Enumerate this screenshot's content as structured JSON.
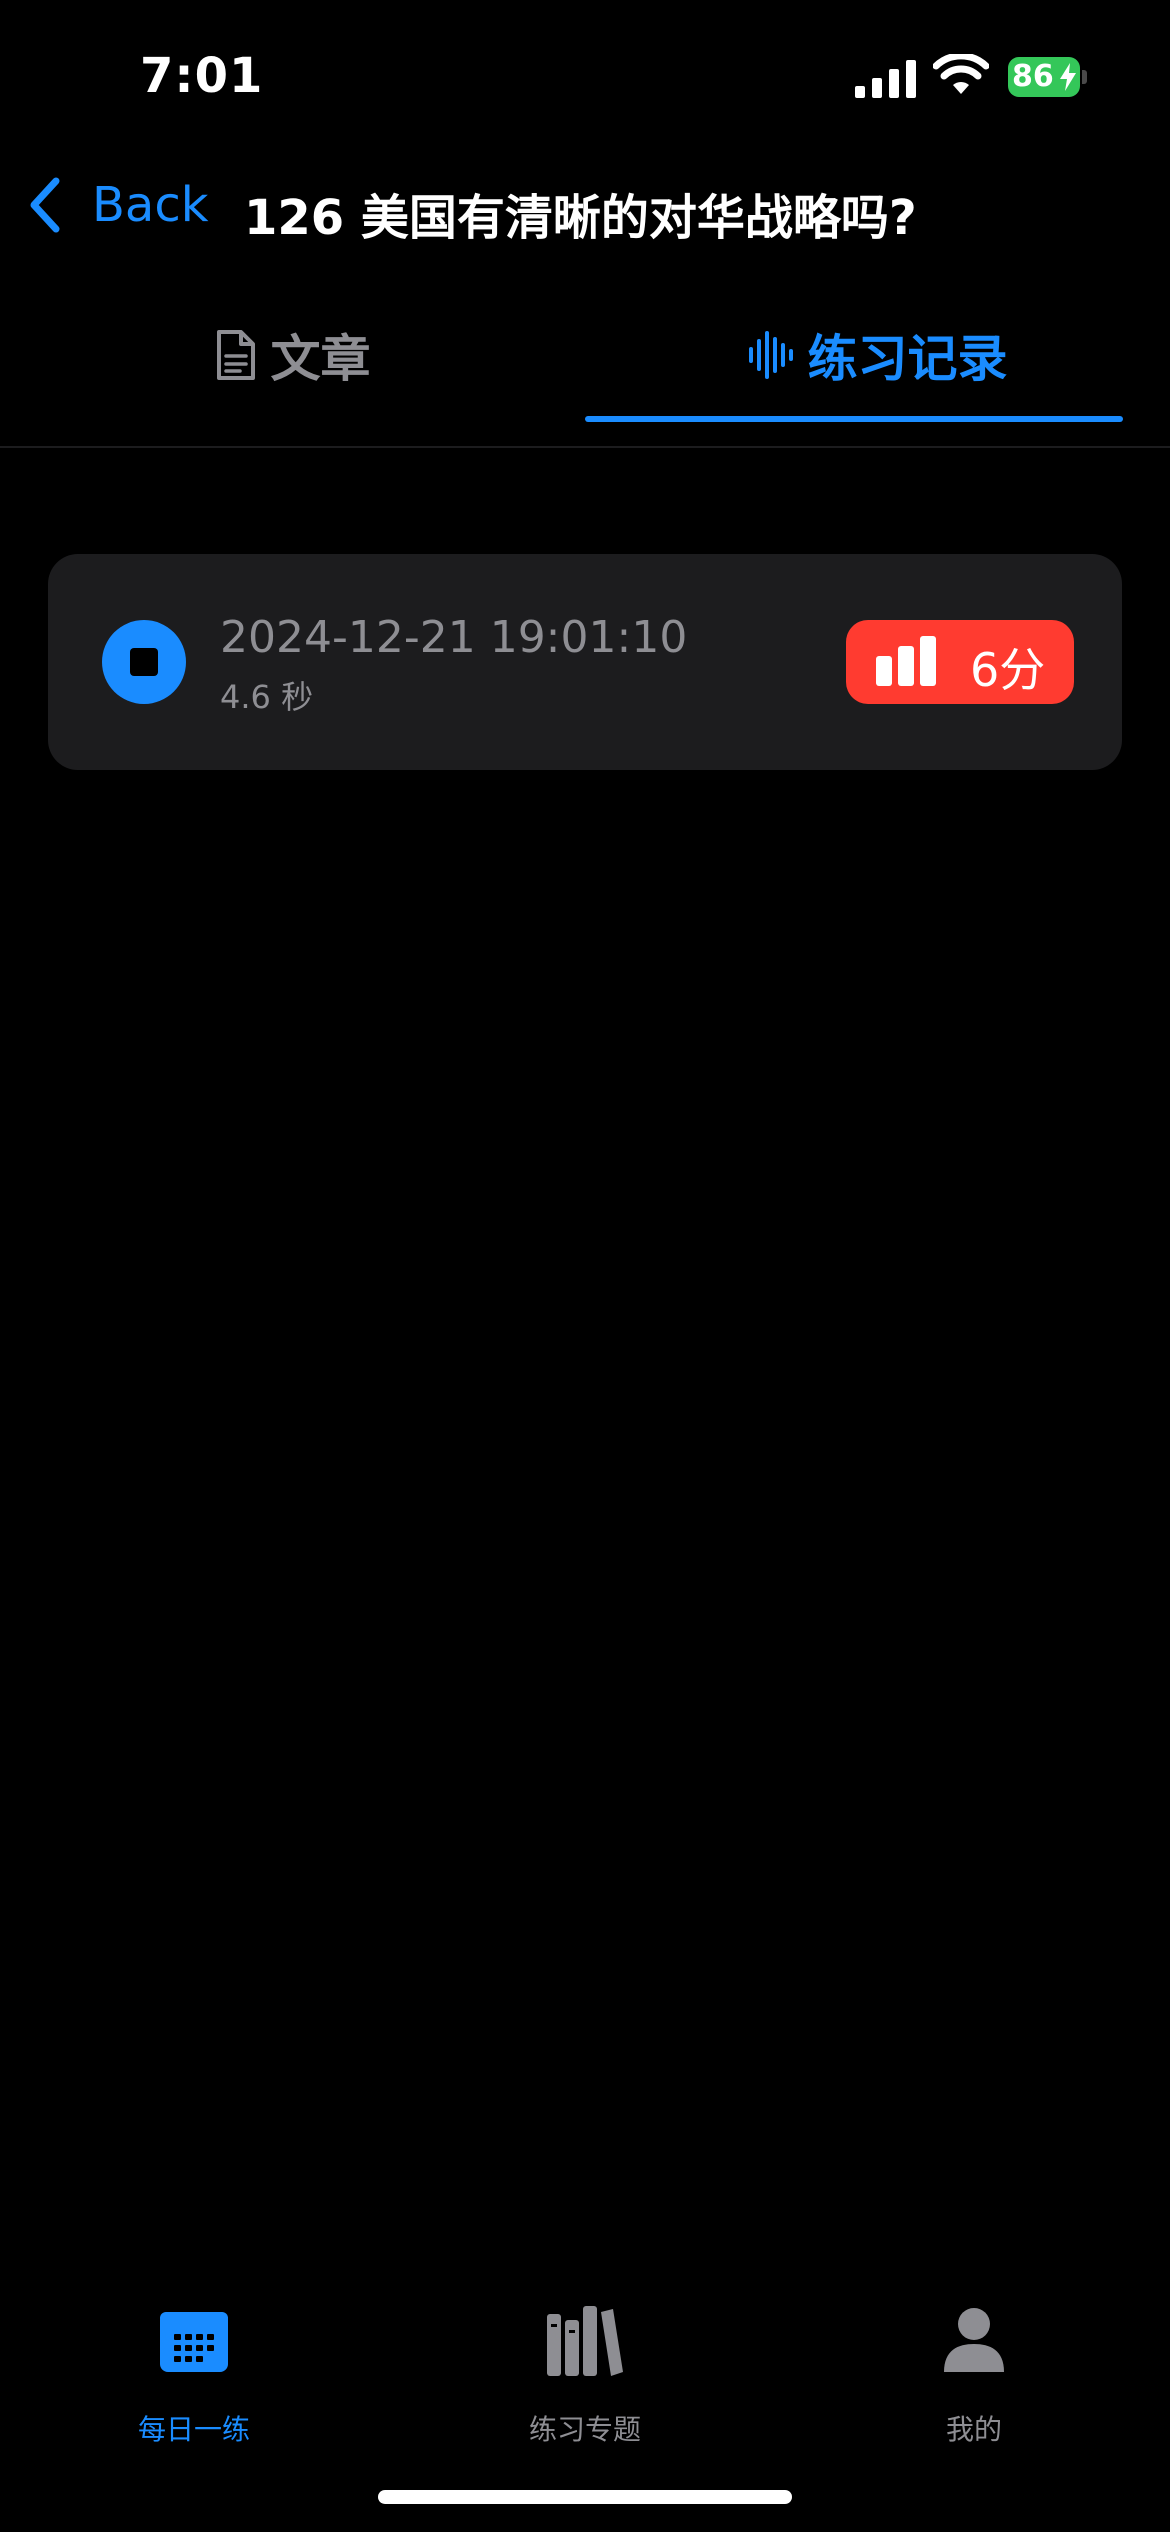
{
  "status_bar": {
    "time": "7:01",
    "battery_percent": "86",
    "battery_charging": true
  },
  "nav": {
    "back_label": "Back",
    "title": "126 美国有清晰的对华战略吗?"
  },
  "tabs": [
    {
      "label": "文章",
      "icon": "document-icon",
      "selected": false
    },
    {
      "label": "练习记录",
      "icon": "waveform-icon",
      "selected": true
    }
  ],
  "records": [
    {
      "datetime": "2024-12-21 19:01:10",
      "duration": "4.6 秒",
      "score": "6分"
    }
  ],
  "bottom_tabs": [
    {
      "label": "每日一练",
      "icon": "calendar-icon",
      "selected": true
    },
    {
      "label": "练习专题",
      "icon": "books-icon",
      "selected": false
    },
    {
      "label": "我的",
      "icon": "person-icon",
      "selected": false
    }
  ],
  "colors": {
    "accent": "#1a8cff",
    "score_badge": "#ff3b30",
    "card": "#1c1c1e",
    "muted": "#8e8e93",
    "battery": "#34c759"
  }
}
